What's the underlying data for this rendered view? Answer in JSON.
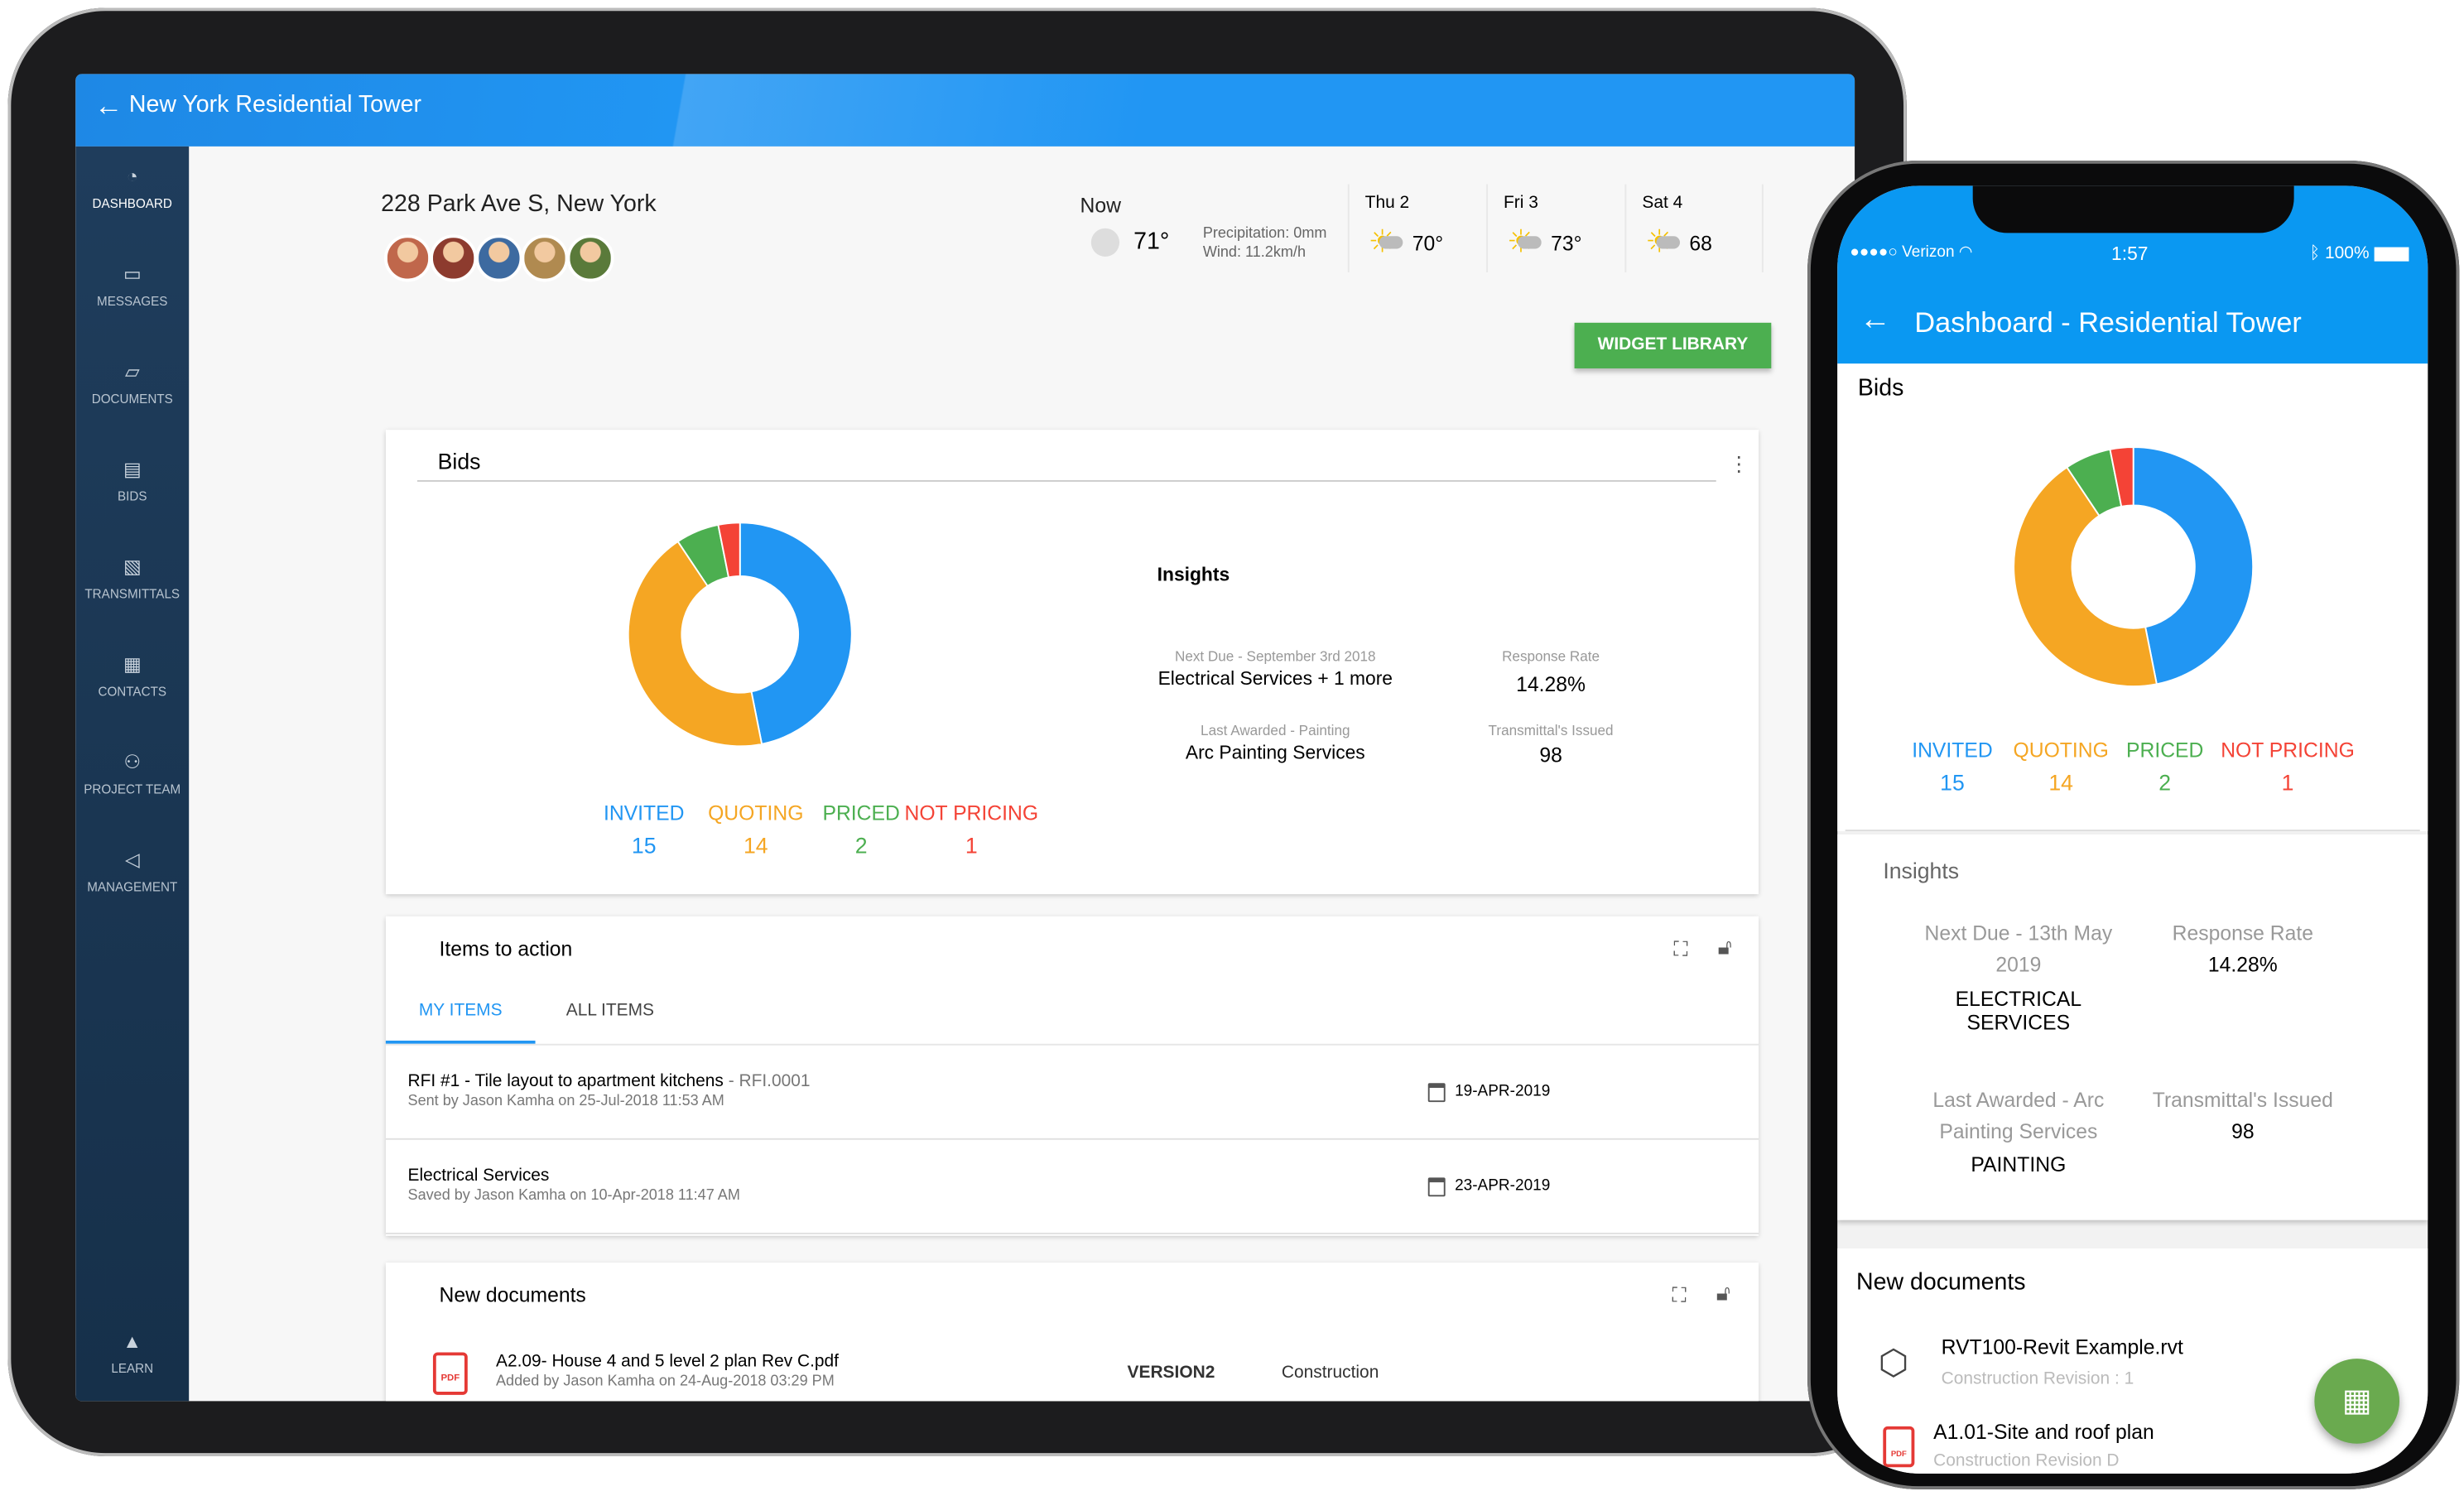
{
  "colors": {
    "invited": "#2196f3",
    "quoting": "#f5a623",
    "priced": "#4caf50",
    "not_pricing": "#f44336",
    "header": "#2196f3",
    "accent_green": "#4caf50"
  },
  "tablet": {
    "header": {
      "back_icon": "arrow-left-icon",
      "title": "New York Residential Tower"
    },
    "sidebar": [
      {
        "label": "DASHBOARD",
        "icon": "◔"
      },
      {
        "label": "MESSAGES",
        "icon": "▭"
      },
      {
        "label": "DOCUMENTS",
        "icon": "▱"
      },
      {
        "label": "BIDS",
        "icon": "▤"
      },
      {
        "label": "TRANSMITTALS",
        "icon": "▧"
      },
      {
        "label": "CONTACTS",
        "icon": "▦"
      },
      {
        "label": "PROJECT TEAM",
        "icon": "⚇"
      },
      {
        "label": "MANAGEMENT",
        "icon": "◁"
      },
      {
        "label": "LEARN",
        "icon": "▲"
      }
    ],
    "address": "228 Park Ave S, New York",
    "weather": {
      "now": {
        "label": "Now",
        "temp": "71°",
        "precip": "Precipitation: 0mm",
        "wind": "Wind: 11.2km/h"
      },
      "days": [
        {
          "day": "Thu 2",
          "temp": "70°",
          "icon": "partly-cloudy-icon"
        },
        {
          "day": "Fri 3",
          "temp": "73°",
          "icon": "partly-cloudy-icon"
        },
        {
          "day": "Sat 4",
          "temp": "68",
          "icon": "rain-icon"
        }
      ]
    },
    "widget_library": "WIDGET LIBRARY",
    "bids": {
      "title": "Bids",
      "insights_title": "Insights",
      "next_due_label": "Next Due - September 3rd 2018",
      "next_due_value": "Electrical Services + 1 more",
      "response_label": "Response Rate",
      "response_value": "14.28%",
      "awarded_label": "Last Awarded - Painting",
      "awarded_value": "Arc Painting Services",
      "transmittals_label": "Transmittal's Issued",
      "transmittals_value": "98"
    },
    "items": {
      "title": "Items to action",
      "tabs": [
        "MY ITEMS",
        "ALL ITEMS"
      ],
      "rows": [
        {
          "title": "RFI #1 - Tile layout to apartment kitchens",
          "ref": "- RFI.0001",
          "sub": "Sent by Jason Kamha on 25-Jul-2018 11:53 AM",
          "date": "19-APR-2019"
        },
        {
          "title": "Electrical Services",
          "ref": "",
          "sub": "Saved by Jason Kamha on 10-Apr-2018 11:47 AM",
          "date": "23-APR-2019"
        }
      ]
    },
    "docs": {
      "title": "New documents",
      "rows": [
        {
          "name": "A2.09- House 4 and 5 level 2 plan Rev C.pdf",
          "sub": "Added by Jason Kamha on 24-Aug-2018 03:29 PM",
          "version": "VERSION2",
          "type": "Construction"
        }
      ]
    }
  },
  "phone": {
    "status": {
      "carrier": "Verizon",
      "time": "1:57",
      "battery": "100%"
    },
    "title": "Dashboard - Residential Tower",
    "bids_title": "Bids",
    "insights": {
      "title": "Insights",
      "next_due_label": "Next Due - 13th May 2019",
      "next_due_value": "ELECTRICAL SERVICES",
      "response_label": "Response Rate",
      "response_value": "14.28%",
      "awarded_label": "Last Awarded - Arc Painting Services",
      "awarded_value": "PAINTING",
      "transmittals_label": "Transmittal's Issued",
      "transmittals_value": "98"
    },
    "docs": {
      "title": "New documents",
      "rows": [
        {
          "name": "RVT100-Revit Example.rvt",
          "sub": "Construction Revision : 1"
        },
        {
          "name": "A1.01-Site and roof plan",
          "sub": "Construction Revision  D"
        }
      ]
    }
  },
  "chart_data": {
    "type": "pie",
    "donut": true,
    "categories": [
      "INVITED",
      "QUOTING",
      "PRICED",
      "NOT PRICING"
    ],
    "values": [
      15,
      14,
      2,
      1
    ]
  }
}
